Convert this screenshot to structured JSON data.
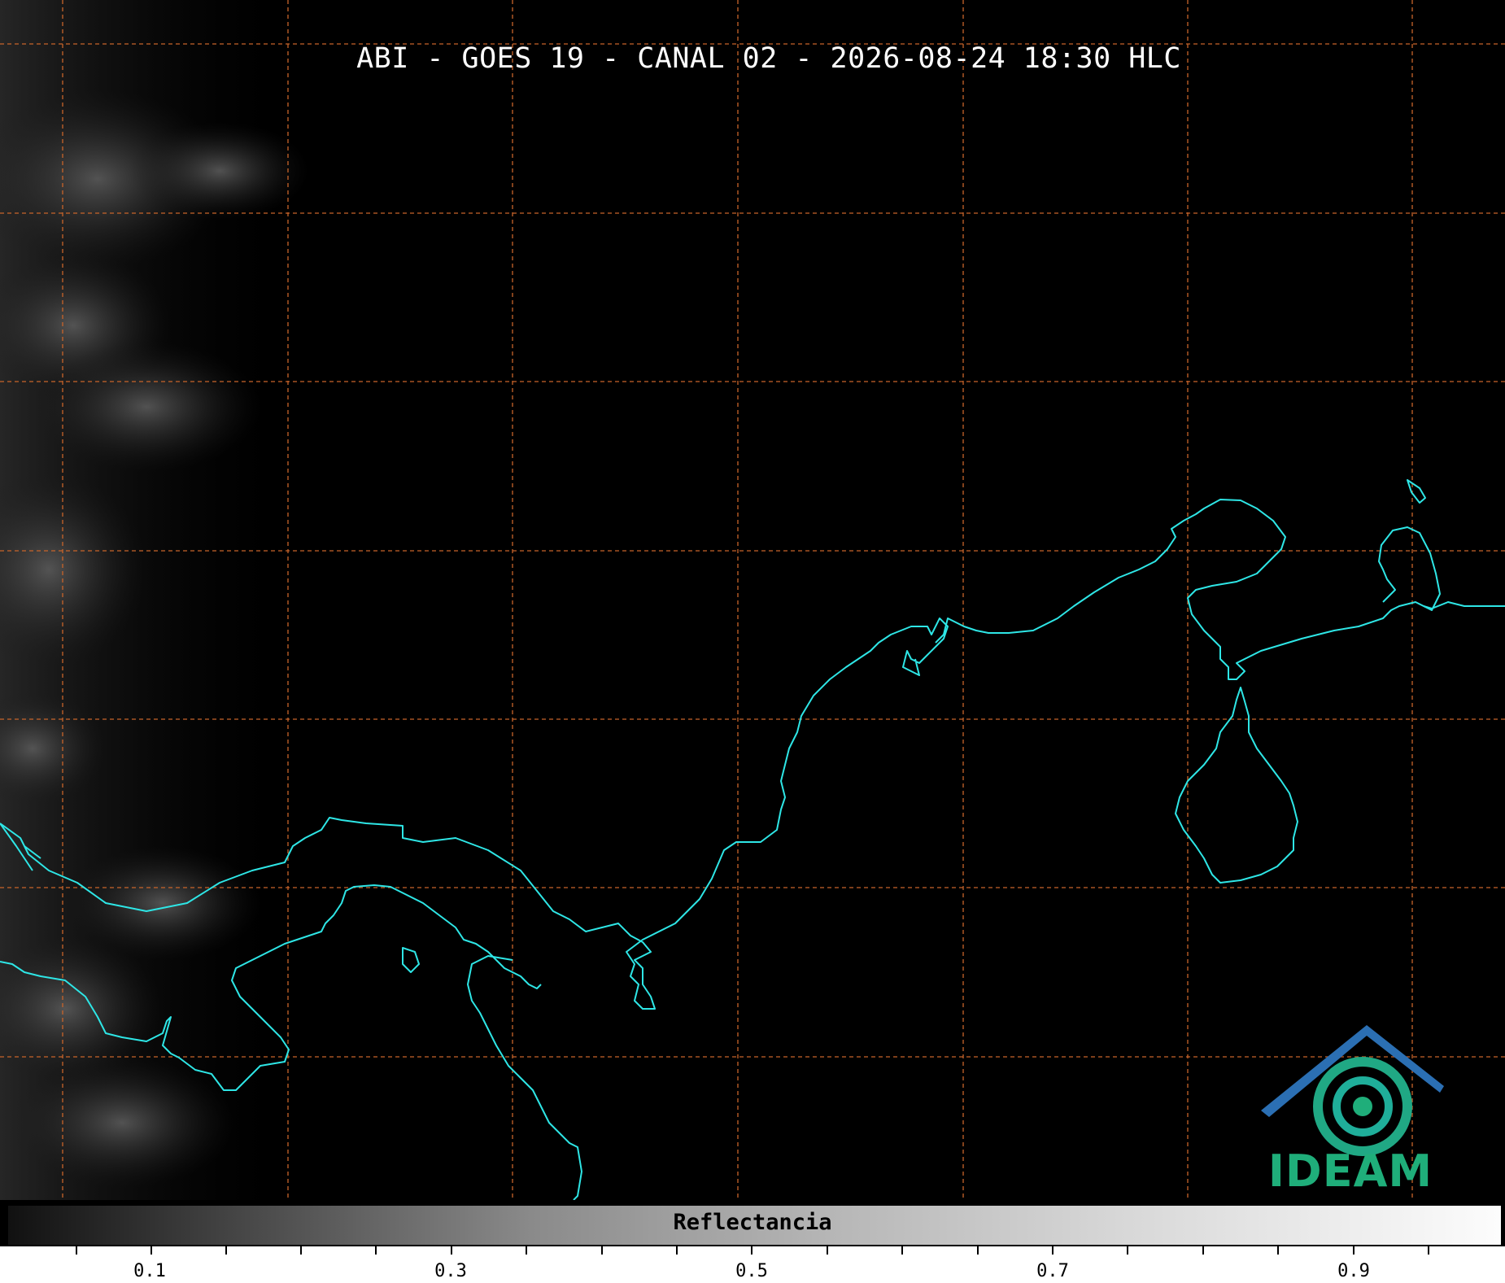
{
  "title": "ABI - GOES 19 - CANAL 02 - 2026-08-24 18:30 HLC",
  "logo": {
    "text": "IDEAM",
    "icon": "ideam-logo-icon",
    "color_primary": "#1fae7a",
    "color_roof": "#2b6fb3"
  },
  "colorbar": {
    "label": "Reflectancia",
    "tick_labels": [
      "0.1",
      "0.3",
      "0.5",
      "0.7",
      "0.9"
    ],
    "colormap": "grayscale"
  },
  "colors": {
    "coastline": "#2ee6e6",
    "gridlines": "#c8642a",
    "background": "#000000"
  }
}
